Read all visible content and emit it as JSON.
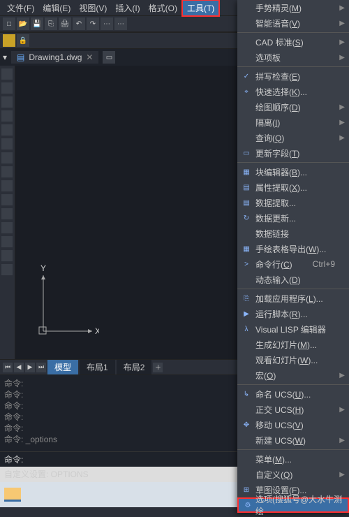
{
  "menubar": [
    "文件(F)",
    "编辑(E)",
    "视图(V)",
    "插入(I)",
    "格式(O)",
    "工具(T)"
  ],
  "menubar_active_index": 5,
  "file_tab": "Drawing1.dwg",
  "layout_tabs": {
    "active": "模型",
    "others": [
      "布局1",
      "布局2"
    ]
  },
  "axis": {
    "x": "X",
    "y": "Y"
  },
  "cmdhist": [
    "命令:",
    "命令:",
    "命令:",
    "命令:",
    "命令:",
    "命令: _options"
  ],
  "cmdline_prompt": "命令:",
  "status": "自定义设置: OPTIONS",
  "dropdown": [
    {
      "t": "i",
      "label": "手势精灵(M)",
      "arrow": true
    },
    {
      "t": "i",
      "label": "智能语音(V)",
      "arrow": true
    },
    {
      "t": "sep"
    },
    {
      "t": "i",
      "label": "CAD 标准(S)",
      "arrow": true
    },
    {
      "t": "i",
      "label": "选项板",
      "arrow": true
    },
    {
      "t": "sep"
    },
    {
      "t": "i",
      "label": "拼写检查(E)",
      "icon": "✓"
    },
    {
      "t": "i",
      "label": "快速选择(K)...",
      "icon": "⌖"
    },
    {
      "t": "i",
      "label": "绘图顺序(D)",
      "arrow": true
    },
    {
      "t": "i",
      "label": "隔离(I)",
      "arrow": true
    },
    {
      "t": "i",
      "label": "查询(Q)",
      "arrow": true
    },
    {
      "t": "i",
      "label": "更新字段(T)",
      "icon": "▭"
    },
    {
      "t": "sep"
    },
    {
      "t": "i",
      "label": "块编辑器(B)...",
      "icon": "▦"
    },
    {
      "t": "i",
      "label": "属性提取(X)...",
      "icon": "▤"
    },
    {
      "t": "i",
      "label": "数据提取...",
      "icon": "▤"
    },
    {
      "t": "i",
      "label": "数据更新...",
      "icon": "↻"
    },
    {
      "t": "i",
      "label": "数据链接"
    },
    {
      "t": "i",
      "label": "手绘表格导出(W)...",
      "icon": "▦"
    },
    {
      "t": "i",
      "label": "命令行(C)",
      "icon": ">",
      "shortcut": "Ctrl+9"
    },
    {
      "t": "i",
      "label": "动态输入(D)"
    },
    {
      "t": "sep"
    },
    {
      "t": "i",
      "label": "加载应用程序(L)...",
      "icon": "⎘"
    },
    {
      "t": "i",
      "label": "运行脚本(R)...",
      "icon": "▶"
    },
    {
      "t": "i",
      "label": "Visual LISP 编辑器",
      "icon": "λ"
    },
    {
      "t": "i",
      "label": "生成幻灯片(M)..."
    },
    {
      "t": "i",
      "label": "观看幻灯片(W)..."
    },
    {
      "t": "i",
      "label": "宏(O)",
      "arrow": true
    },
    {
      "t": "sep"
    },
    {
      "t": "i",
      "label": "命名 UCS(U)...",
      "icon": "↳"
    },
    {
      "t": "i",
      "label": "正交 UCS(H)",
      "arrow": true
    },
    {
      "t": "i",
      "label": "移动 UCS(V)",
      "icon": "✥"
    },
    {
      "t": "i",
      "label": "新建 UCS(W)",
      "arrow": true
    },
    {
      "t": "sep"
    },
    {
      "t": "i",
      "label": "菜单(M)..."
    },
    {
      "t": "i",
      "label": "自定义(Q)",
      "arrow": true
    },
    {
      "t": "i",
      "label": "草图设置(F)...",
      "icon": "⊞"
    },
    {
      "t": "i",
      "label": "选项(搜狐号@大水牛测绘",
      "icon": "⚙",
      "hl": true
    }
  ]
}
